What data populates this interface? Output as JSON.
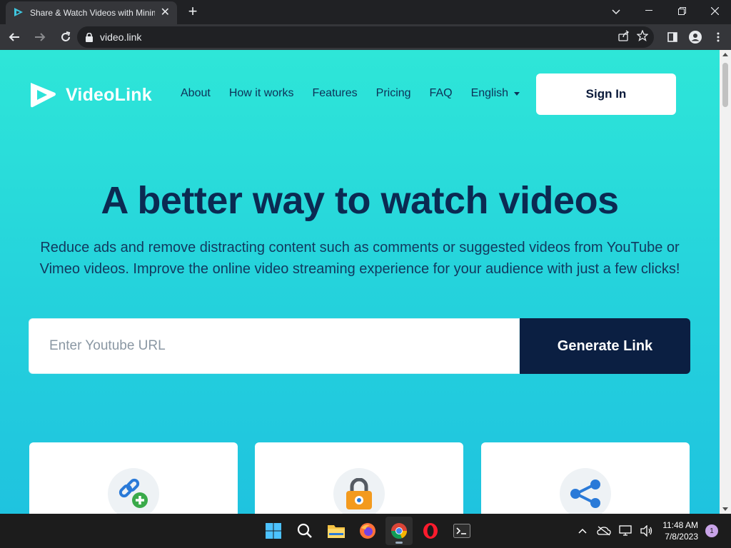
{
  "browser": {
    "tab_title": "Share & Watch Videos with Minimal Distractions",
    "url": "video.link",
    "new_tab_symbol": "+",
    "tab_close_symbol": "✕"
  },
  "site": {
    "logo_text": "VideoLink",
    "nav": [
      "About",
      "How it works",
      "Features",
      "Pricing",
      "FAQ"
    ],
    "language": "English",
    "signin_label": "Sign In",
    "hero_title": "A better way to watch videos",
    "hero_subtitle": "Reduce ads and remove distracting content such as comments or suggested videos from YouTube or Vimeo videos. Improve the online video streaming experience for your audience with just a few clicks!",
    "url_placeholder": "Enter Youtube URL",
    "generate_label": "Generate Link",
    "cards": [
      {
        "icon": "link-add-icon"
      },
      {
        "icon": "lock-icon"
      },
      {
        "icon": "share-icon"
      }
    ]
  },
  "taskbar": {
    "apps": [
      "windows-start",
      "search",
      "file-explorer",
      "firefox",
      "chrome",
      "opera",
      "terminal"
    ],
    "active_app": "chrome",
    "time": "11:48 AM",
    "date": "7/8/2023",
    "notification_count": "1"
  },
  "colors": {
    "brand_dark": "#0b1f42",
    "hero_text": "#0b2a52",
    "gradient_top": "#2ee6d8",
    "gradient_bottom": "#1fc3df"
  }
}
